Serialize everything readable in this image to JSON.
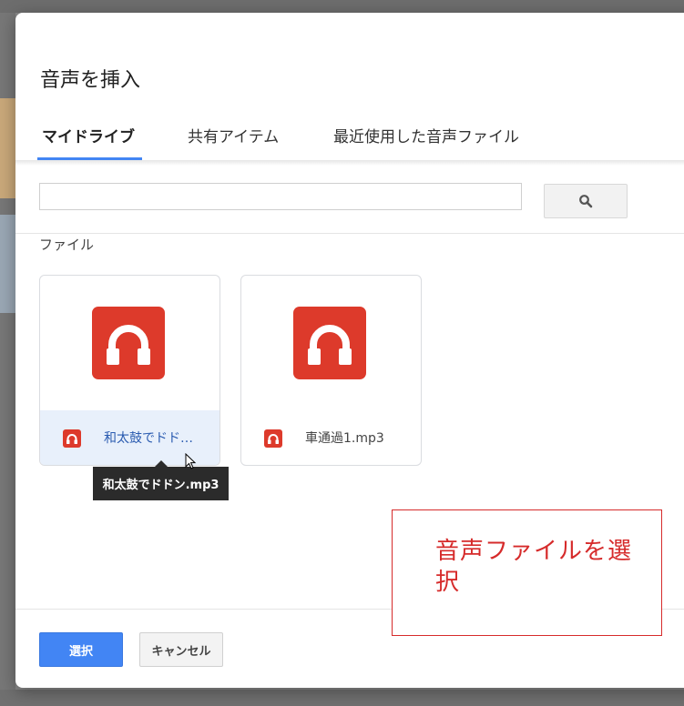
{
  "dialog": {
    "title": "音声を挿入",
    "tabs": [
      {
        "label": "マイドライブ",
        "active": true
      },
      {
        "label": "共有アイテム",
        "active": false
      },
      {
        "label": "最近使用した音声ファイル",
        "active": false
      }
    ],
    "search": {
      "value": "",
      "button_icon": "search-icon"
    },
    "section_label": "ファイル",
    "files": [
      {
        "name": "和太鼓でドド…",
        "icon": "headphones-icon",
        "selected": true
      },
      {
        "name": "車通過1.mp3",
        "icon": "headphones-icon",
        "selected": false
      }
    ],
    "tooltip": "和太鼓でドドン.mp3",
    "buttons": {
      "select": "選択",
      "cancel": "キャンセル"
    }
  },
  "annotation": {
    "text": "音声ファイルを選択"
  },
  "colors": {
    "accent": "#4285f4",
    "audio_icon": "#dd3a2b",
    "annotation": "#d62b2b",
    "selected_bg": "#e8f0fb"
  }
}
